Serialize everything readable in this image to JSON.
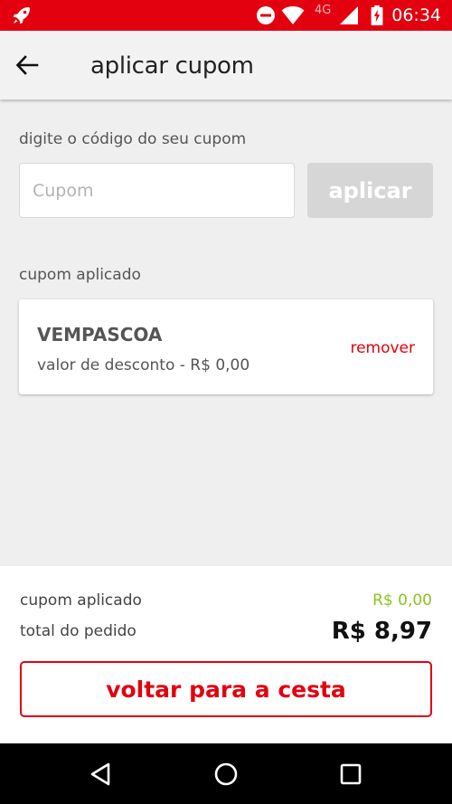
{
  "status_bar": {
    "network": "4G",
    "time": "06:34",
    "icons": [
      "app-rocket-icon",
      "do-not-disturb-icon",
      "wifi-icon",
      "cell-signal-icon",
      "battery-charging-icon"
    ]
  },
  "app_bar": {
    "title": "aplicar cupom",
    "back_icon": "arrow-left-icon"
  },
  "coupon_form": {
    "label": "digite o código do seu cupom",
    "input_value": "",
    "input_placeholder": "Cupom",
    "apply_label": "aplicar"
  },
  "applied_section": {
    "label": "cupom aplicado",
    "coupon": {
      "code": "VEMPASCOA",
      "description": "valor de desconto - R$ 0,00",
      "remove_label": "remover"
    }
  },
  "summary": {
    "discount_label": "cupom aplicado",
    "discount_value": "R$ 0,00",
    "total_label": "total do pedido",
    "total_value": "R$ 8,97",
    "back_button_label": "voltar para a cesta"
  },
  "nav_bar": {
    "icons": [
      "back-triangle-icon",
      "home-circle-icon",
      "recents-square-icon"
    ]
  },
  "colors": {
    "brand_red": "#e3000f",
    "discount_green": "#8fc31f",
    "disabled_gray": "#d6d6d6",
    "background": "#efefef"
  }
}
